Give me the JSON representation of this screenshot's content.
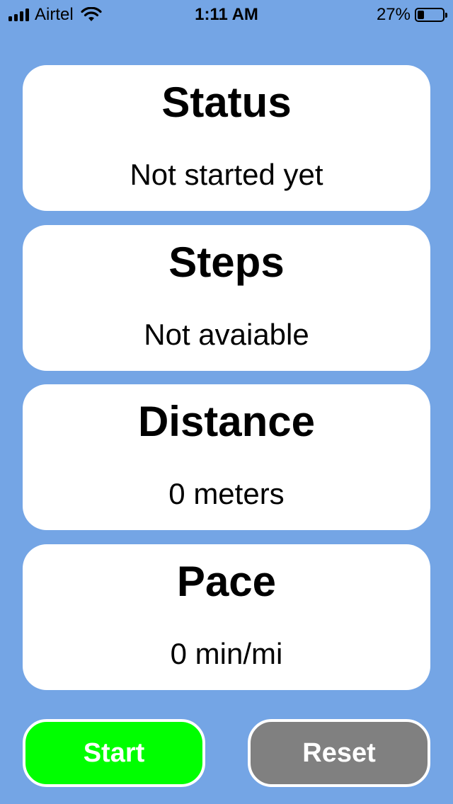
{
  "status_bar": {
    "carrier": "Airtel",
    "time": "1:11 AM",
    "battery_percent": "27%",
    "battery_level": 0.27,
    "icons": [
      "signal-icon",
      "wifi-icon",
      "battery-icon"
    ]
  },
  "cards": {
    "status": {
      "title": "Status",
      "value": "Not started yet"
    },
    "steps": {
      "title": "Steps",
      "value": "Not avaiable"
    },
    "distance": {
      "title": "Distance",
      "value": "0 meters"
    },
    "pace": {
      "title": "Pace",
      "value": "0 min/mi"
    }
  },
  "buttons": {
    "start_label": "Start",
    "reset_label": "Reset"
  },
  "colors": {
    "background": "#74a5e5",
    "card": "#ffffff",
    "start": "#00ff00",
    "reset": "#808080"
  }
}
